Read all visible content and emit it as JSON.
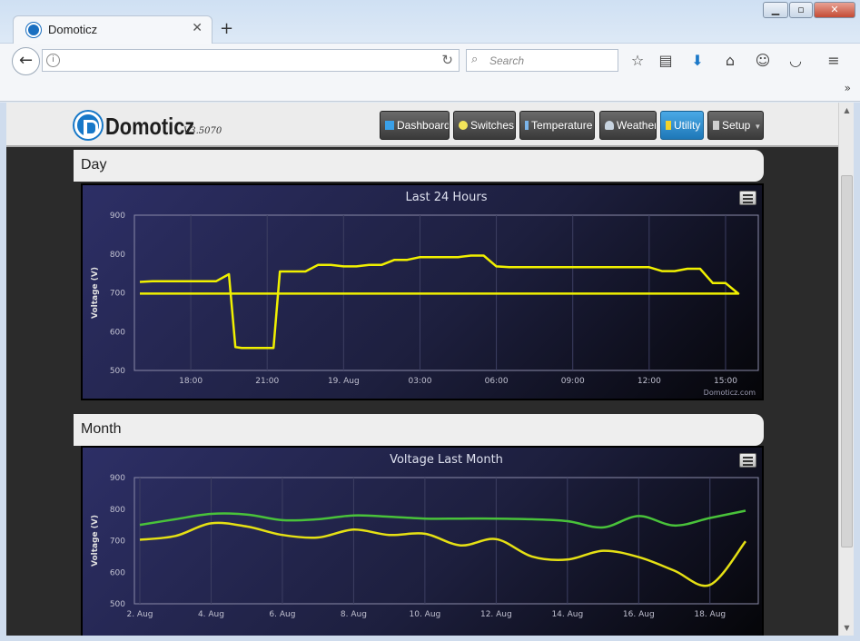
{
  "browser": {
    "tab_title": "Domoticz",
    "search_placeholder": "Search",
    "icons": [
      "back-icon",
      "info-icon",
      "reload-icon",
      "search-icon",
      "bookmark-star-icon",
      "reading-list-icon",
      "download-icon",
      "home-icon",
      "emoji-icon",
      "pocket-icon",
      "menu-icon"
    ]
  },
  "app": {
    "logo_text": "Domoticz",
    "version": "V3.5070",
    "nav": [
      {
        "label": "Dashboard",
        "icon": "monitor-icon",
        "active": false
      },
      {
        "label": "Switches",
        "icon": "bulb-icon",
        "active": false
      },
      {
        "label": "Temperature",
        "icon": "thermometer-icon",
        "active": false
      },
      {
        "label": "Weather",
        "icon": "cloud-icon",
        "active": false
      },
      {
        "label": "Utility",
        "icon": "lightning-icon",
        "active": true
      },
      {
        "label": "Setup",
        "icon": "tools-icon",
        "active": false,
        "dropdown": true
      }
    ]
  },
  "sections": {
    "day": "Day",
    "month": "Month"
  },
  "colors": {
    "line_day": "#f0f000",
    "line_month_green": "#49c23a",
    "line_month_yellow": "#e5e014",
    "active_nav": "#2d8fd2"
  },
  "chart_data": [
    {
      "type": "line",
      "title": "Last 24 Hours",
      "ylabel": "Voltage (V)",
      "xlabel": "",
      "ylim": [
        500,
        900
      ],
      "yticks": [
        500,
        600,
        700,
        800,
        900
      ],
      "x_tick_labels": [
        "18:00",
        "21:00",
        "19. Aug",
        "03:00",
        "06:00",
        "09:00",
        "12:00",
        "15:00"
      ],
      "credit": "Domoticz.com",
      "series": [
        {
          "x": [
            "16:00",
            "16:30",
            "17:00",
            "17:30",
            "18:00",
            "18:30",
            "19:00",
            "19:30",
            "19:45",
            "20:00",
            "20:30",
            "21:00",
            "21:15",
            "21:30",
            "22:00",
            "22:30",
            "23:00",
            "23:30",
            "00:00",
            "00:30",
            "01:00",
            "01:30",
            "02:00",
            "02:30",
            "03:00",
            "03:30",
            "04:00",
            "04:30",
            "05:00",
            "05:30",
            "06:00",
            "06:30",
            "07:00",
            "08:00",
            "09:00",
            "10:00",
            "11:00",
            "12:00",
            "12:30",
            "13:00",
            "13:30",
            "14:00",
            "14:30",
            "15:00",
            "15:30",
            "16:00"
          ],
          "values": [
            728,
            730,
            730,
            730,
            730,
            730,
            730,
            748,
            560,
            558,
            558,
            558,
            558,
            755,
            755,
            755,
            772,
            772,
            768,
            768,
            772,
            772,
            785,
            785,
            792,
            792,
            792,
            792,
            796,
            796,
            768,
            766,
            766,
            766,
            766,
            766,
            766,
            766,
            756,
            756,
            762,
            762,
            725,
            725,
            698,
            698
          ]
        }
      ]
    },
    {
      "type": "line",
      "title": "Voltage Last Month",
      "ylabel": "Voltage (V)",
      "xlabel": "",
      "ylim": [
        500,
        900
      ],
      "yticks": [
        500,
        600,
        700,
        800,
        900
      ],
      "categories": [
        "2. Aug",
        "3. Aug",
        "4. Aug",
        "5. Aug",
        "6. Aug",
        "7. Aug",
        "8. Aug",
        "9. Aug",
        "10. Aug",
        "11. Aug",
        "12. Aug",
        "13. Aug",
        "14. Aug",
        "15. Aug",
        "16. Aug",
        "17. Aug",
        "18. Aug",
        "19. Aug"
      ],
      "x_tick_labels": [
        "2. Aug",
        "4. Aug",
        "6. Aug",
        "8. Aug",
        "10. Aug",
        "12. Aug",
        "14. Aug",
        "16. Aug",
        "18. Aug"
      ],
      "series": [
        {
          "values": [
            750,
            768,
            785,
            783,
            765,
            768,
            780,
            776,
            770,
            770,
            770,
            768,
            762,
            742,
            778,
            748,
            772,
            795
          ]
        },
        {
          "values": [
            703,
            715,
            755,
            745,
            718,
            710,
            735,
            718,
            722,
            685,
            705,
            650,
            640,
            668,
            648,
            605,
            560,
            698
          ]
        }
      ]
    }
  ]
}
